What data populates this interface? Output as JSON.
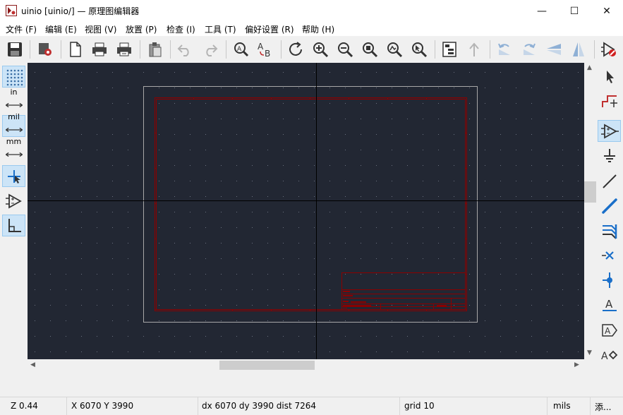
{
  "window": {
    "title": "uinio [uinio/] — 原理图编辑器",
    "minimize_glyph": "—",
    "maximize_glyph": "☐",
    "close_glyph": "✕"
  },
  "menu": [
    {
      "label": "文件 (F)"
    },
    {
      "label": "编辑 (E)"
    },
    {
      "label": "视图 (V)"
    },
    {
      "label": "放置 (P)"
    },
    {
      "label": "检查 (I)"
    },
    {
      "label": "工具 (T)"
    },
    {
      "label": "偏好设置 (R)"
    },
    {
      "label": "帮助 (H)"
    }
  ],
  "toolbar": {
    "icons": [
      "save-icon",
      "schematic-setup-icon",
      "page-settings-icon",
      "print-icon",
      "plot-icon",
      "paste-icon",
      "undo-icon",
      "redo-icon",
      "find-icon",
      "find-replace-icon",
      "refresh-icon",
      "zoom-in-icon",
      "zoom-out-icon",
      "zoom-fit-icon",
      "zoom-objects-icon",
      "zoom-selection-icon",
      "hierarchy-navigator-icon",
      "leave-sheet-icon",
      "rotate-ccw-icon",
      "rotate-cw-icon",
      "mirror-vertical-icon",
      "mirror-horizontal-icon",
      "symbol-editor-icon"
    ]
  },
  "left_toolbar": {
    "units_in": "in",
    "units_mil": "mil",
    "units_mm": "mm"
  },
  "status": {
    "zoom": "Z 0.44",
    "xy": "X 6070  Y 3990",
    "delta": "dx 6070  dy 3990  dist 7264",
    "grid": "grid 10",
    "units": "mils",
    "mode": "添..."
  },
  "colors": {
    "canvas_bg": "#222733",
    "page_border": "#a8a8a8",
    "sheet_frame": "#8b0000",
    "crosshair": "#000000",
    "accent": "#1a6fc9"
  }
}
